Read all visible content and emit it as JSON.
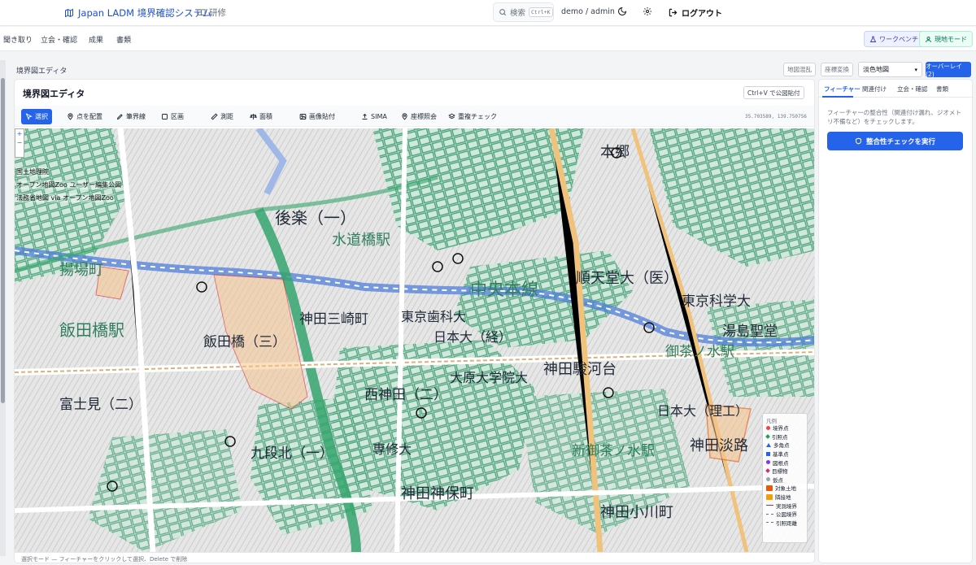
{
  "header": {
    "app_title": "Japan LADM 境界確認システム",
    "training_label": "研修",
    "search_placeholder": "検索",
    "search_shortcut": "Ctrl+K",
    "user": "demo / admin",
    "logout_label": "ログアウト"
  },
  "nav": {
    "items": [
      "聞き取り",
      "立会・確認",
      "成果",
      "書類"
    ],
    "workbench_label": "ワークベンチ",
    "field_mode_label": "現地モード"
  },
  "breadcrumb": "境界図エディタ",
  "map_controls": {
    "clip_label": "地図混乱",
    "coord_convert_label": "座標変換",
    "basemap_selected": "淡色地図",
    "overlay_label": "オーバーレイ (2)"
  },
  "editor": {
    "title": "境界図エディタ",
    "paste_label": "Ctrl+V で公図貼付",
    "tools": [
      {
        "label": "選択",
        "icon": "cursor-icon",
        "active": true
      },
      {
        "label": "点を配置",
        "icon": "pin-icon"
      },
      {
        "label": "筆界線",
        "icon": "pen-icon"
      },
      {
        "label": "区画",
        "icon": "square-icon"
      },
      {
        "label": "測距",
        "icon": "ruler-icon"
      },
      {
        "label": "面積",
        "icon": "scale-icon"
      },
      {
        "label": "画像貼付",
        "icon": "image-icon"
      },
      {
        "label": "SIMA",
        "icon": "upload-icon"
      },
      {
        "label": "座標照会",
        "icon": "pin-icon"
      },
      {
        "label": "重複チェック",
        "icon": "layers-icon"
      }
    ],
    "coordinates": "35.703589, 139.750756",
    "status": "選択モード — フィーチャーをクリックして選択、Delete で削除"
  },
  "map": {
    "attribution": [
      "国土地理院",
      "オープン地図Zoo ユーザー編集公図",
      "法務省地図 via オープン地図Zoo"
    ],
    "zoom_in": "+",
    "zoom_out": "−",
    "labels": [
      "飯田橋駅",
      "水道橋駅",
      "後楽（一）",
      "中央本線",
      "順天堂大（医）",
      "東京科学大",
      "湯島聖堂",
      "御茶ノ水駅",
      "神田駿河台",
      "日本大（理工）",
      "神田淡路",
      "神田小川町",
      "神田三崎町",
      "西神田（二）",
      "専修大",
      "新御茶ノ水駅",
      "東京歯科大",
      "日本大（経）",
      "大原大学院大",
      "富士見（二）",
      "飯田橋（三）",
      "九段北（一）",
      "神田神保町",
      "揚場町",
      "本郷"
    ]
  },
  "legend": {
    "title": "凡例",
    "items": [
      {
        "label": "境界点",
        "color": "#ef4444",
        "shape": "dot"
      },
      {
        "label": "引照点",
        "color": "#16a34a",
        "shape": "diamond"
      },
      {
        "label": "多角点",
        "color": "#2563eb",
        "shape": "triangle"
      },
      {
        "label": "基準点",
        "color": "#2563eb",
        "shape": "square"
      },
      {
        "label": "図根点",
        "color": "#7c3aed",
        "shape": "dot"
      },
      {
        "label": "目標物",
        "color": "#db2777",
        "shape": "diamond"
      },
      {
        "label": "仮点",
        "color": "#9ca3af",
        "shape": "dot"
      },
      {
        "label": "対象土地",
        "color": "#ea580c",
        "shape": "box"
      },
      {
        "label": "隣接地",
        "color": "#f59e0b",
        "shape": "box"
      },
      {
        "label": "実測境界",
        "color": "#dc2626",
        "shape": "line"
      },
      {
        "label": "公図境界",
        "color": "#6b7280",
        "shape": "dash"
      },
      {
        "label": "引照距離",
        "color": "#6b7280",
        "shape": "dash"
      }
    ]
  },
  "sidebar": {
    "tabs": [
      "フィーチャー",
      "関連付け",
      "立会・確認",
      "書類"
    ],
    "description": "フィーチャーの整合性（関連付け漏れ、ジオメトリ不備など）をチェックします。",
    "run_button": "整合性チェックを実行"
  },
  "colors": {
    "accent": "#2563eb",
    "map_green": "#3e9b6f",
    "railway": "#4f7fd8",
    "highway": "#34a56d"
  }
}
